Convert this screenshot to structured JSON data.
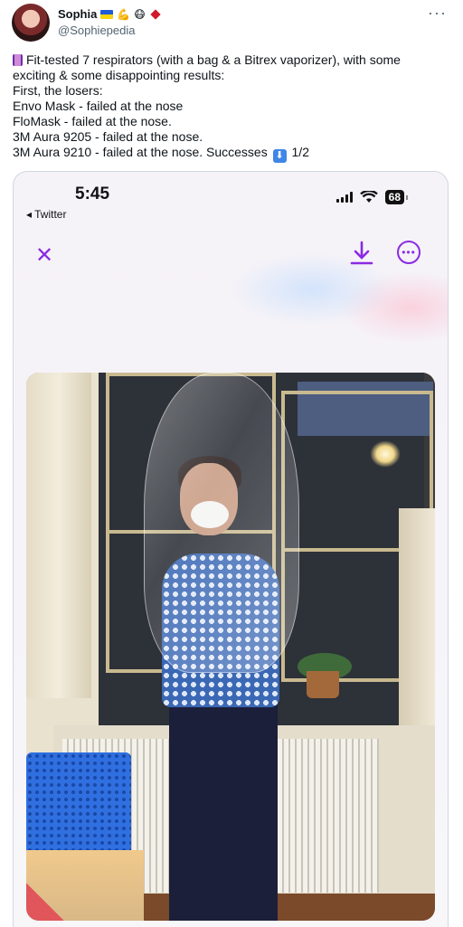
{
  "author": {
    "name": "Sophia",
    "handle": "@Sophiepedia",
    "name_emojis": [
      "ukraine-flag",
      "flexed-biceps",
      "face-with-medical-mask",
      "red-diamond"
    ]
  },
  "tweet": {
    "lines": [
      "Fit-tested 7 respirators (with a bag & a Bitrex vaporizer), with some",
      "exciting & some disappointing results:",
      "First, the losers:",
      "Envo Mask - failed at the nose",
      "FloMask - failed at the nose.",
      "3M Aura 9205 - failed at the nose.",
      "3M Aura 9210 - failed at the nose. Successes"
    ],
    "thread_count": "1/2"
  },
  "media": {
    "phone_time": "5:45",
    "back_label": "Twitter",
    "battery": "68",
    "accent_color": "#8a2be2"
  }
}
